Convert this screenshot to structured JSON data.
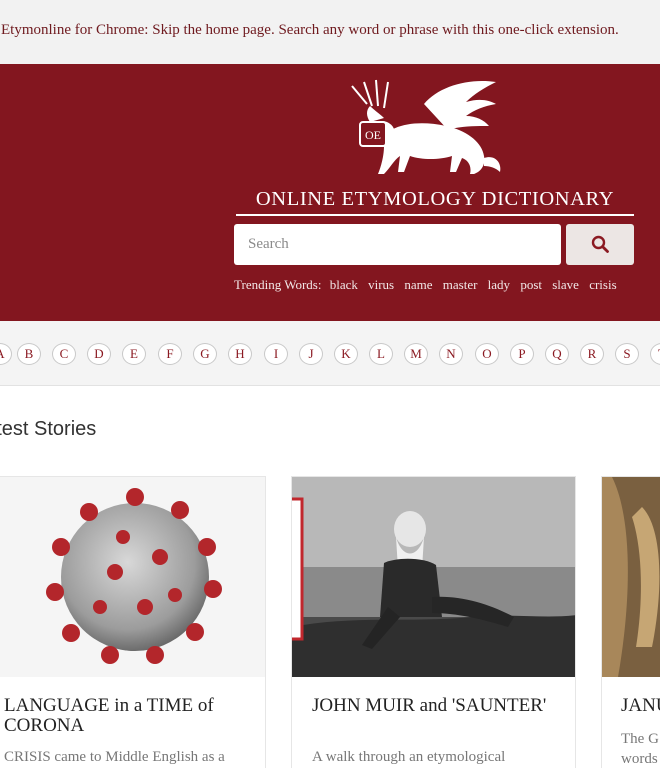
{
  "promo_banner": "Etymonline for Chrome: Skip the home page. Search any word or phrase with this one-click extension.",
  "logo": {
    "text": "ONLINE ETYMOLOGY DICTIONARY",
    "monogram": "OE"
  },
  "search": {
    "placeholder": "Search",
    "button_icon": "search-icon"
  },
  "trending": {
    "label": "Trending Words:",
    "words": [
      "black",
      "virus",
      "name",
      "master",
      "lady",
      "post",
      "slave",
      "crisis"
    ]
  },
  "alphabet": [
    "A",
    "B",
    "C",
    "D",
    "E",
    "F",
    "G",
    "H",
    "I",
    "J",
    "K",
    "L",
    "M",
    "N",
    "O",
    "P",
    "Q",
    "R",
    "S",
    "T"
  ],
  "latest": {
    "title": "Latest Stories",
    "stories": [
      {
        "title": "LANGUAGE in a TIME of CORONA",
        "excerpt": "CRISIS came  to Middle English as a"
      },
      {
        "title": "JOHN MUIR and 'SAUNTER'",
        "excerpt": "A walk through an etymological"
      },
      {
        "title": "JANU",
        "excerpt": "The G",
        "excerpt_2": "words"
      }
    ]
  },
  "colors": {
    "brand": "#83161f",
    "link": "#8b1a22",
    "promo_text": "#6f1a1f"
  }
}
